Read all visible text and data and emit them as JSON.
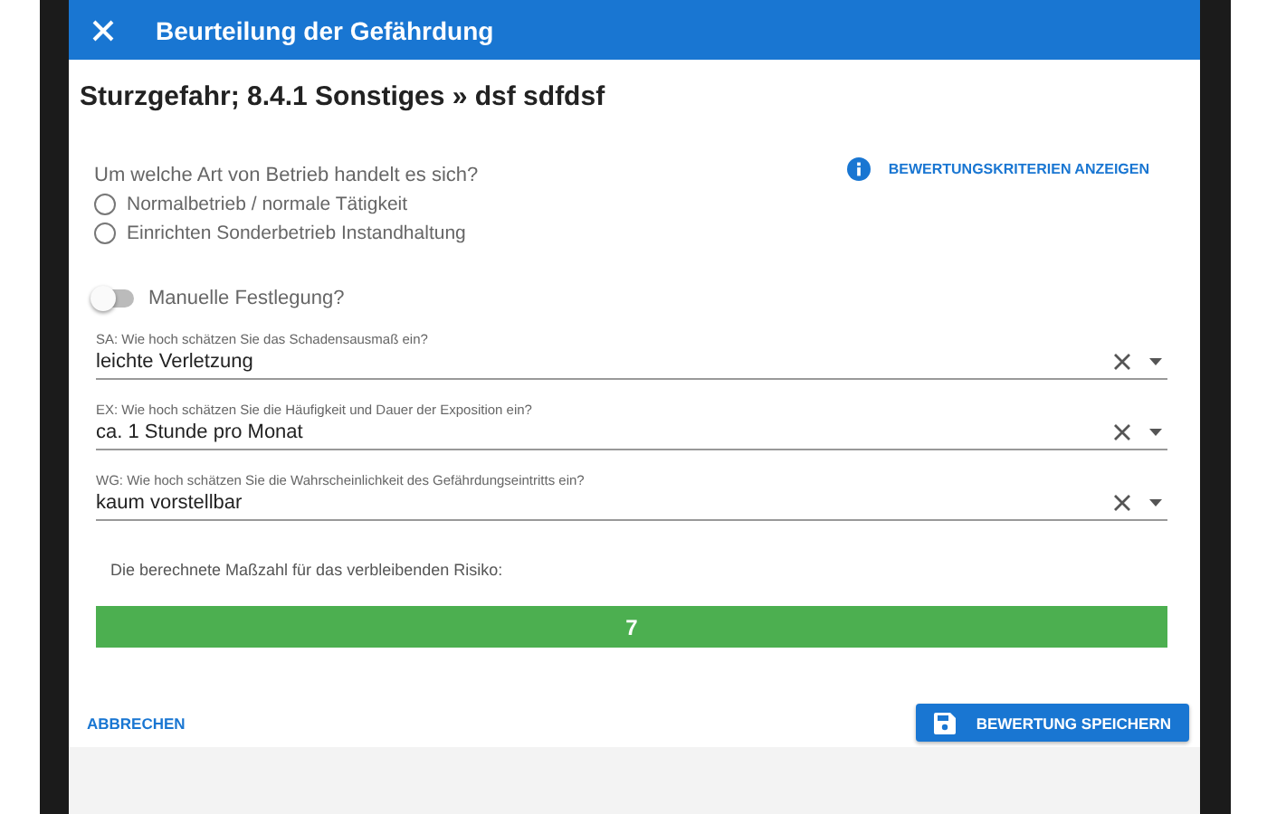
{
  "dialog": {
    "title": "Beurteilung der Gefährdung",
    "heading": "Sturzgefahr; 8.4.1 Sonstiges » dsf sdfdsf"
  },
  "operation": {
    "question": "Um welche Art von Betrieb handelt es sich?",
    "criteria_link": "BEWERTUNGSKRITERIEN ANZEIGEN",
    "options": [
      {
        "label": "Normalbetrieb / normale Tätigkeit",
        "selected": false
      },
      {
        "label": "Einrichten Sonderbetrieb Instandhaltung",
        "selected": false
      }
    ]
  },
  "manual": {
    "label": "Manuelle Festlegung?",
    "on": false
  },
  "fields": [
    {
      "label": "SA: Wie hoch schätzen Sie das Schadensausmaß ein?",
      "value": "leichte Verletzung"
    },
    {
      "label": "EX: Wie hoch schätzen Sie die Häufigkeit und Dauer der Exposition ein?",
      "value": "ca. 1 Stunde pro Monat"
    },
    {
      "label": "WG: Wie hoch schätzen Sie die Wahrscheinlichkeit des Gefährdungseintritts ein?",
      "value": "kaum vorstellbar"
    }
  ],
  "result": {
    "label": "Die berechnete Maßzahl für das verbleibenden Risiko:",
    "value": "7"
  },
  "footer": {
    "cancel": "ABBRECHEN",
    "save": "BEWERTUNG SPEICHERN"
  }
}
